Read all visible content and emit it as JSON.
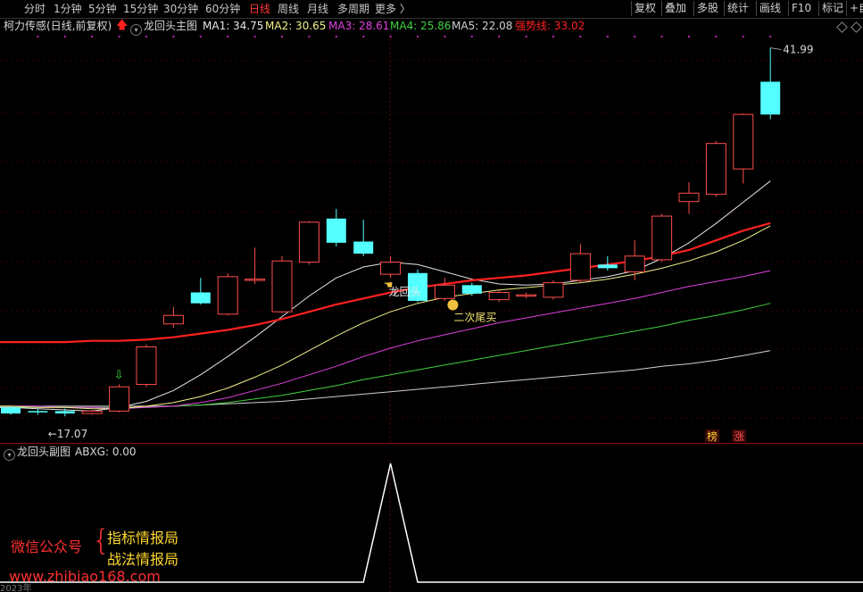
{
  "toolbar": {
    "periods": [
      {
        "label": "分时",
        "active": false
      },
      {
        "label": "1分钟",
        "active": false
      },
      {
        "label": "5分钟",
        "active": false
      },
      {
        "label": "15分钟",
        "active": false
      },
      {
        "label": "30分钟",
        "active": false
      },
      {
        "label": "60分钟",
        "active": false
      },
      {
        "label": "日线",
        "active": true
      },
      {
        "label": "周线",
        "active": false
      },
      {
        "label": "月线",
        "active": false
      },
      {
        "label": "多周期",
        "active": false
      },
      {
        "label": "更多 〉",
        "active": false
      }
    ],
    "tools": [
      "复权",
      "叠加",
      "多股",
      "统计",
      "画线",
      "F10",
      "标记",
      "+自"
    ]
  },
  "infobar": {
    "stock": "柯力传感(日线,前复权)",
    "indicator": "龙回头主图",
    "ma1": "MA1: 34.75",
    "ma2": "MA2: 30.65",
    "ma3": "MA3: 28.61",
    "ma4": "MA4: 25.86",
    "ma5": "MA5: 22.08",
    "strong": "强势线: 33.02"
  },
  "colors": {
    "up": "#ff4d4d",
    "down": "#54ffff",
    "ma1": "#e6e6e6",
    "ma2": "#f0f08a",
    "ma3": "#e040e0",
    "ma4": "#40d040",
    "ma5": "#d0d0d0",
    "strong": "#ff2020",
    "active": "#ff3b3b"
  },
  "chart_data": {
    "type": "candlestick",
    "price_labels": {
      "high": "41.99",
      "low": "17.07"
    },
    "markers": {
      "buy_arrow": "⇩",
      "longhuitou": "龙回头",
      "second_buy": "二次尾买",
      "bang": "榜",
      "zhang": "涨"
    },
    "candles": [
      {
        "o": 17.8,
        "c": 17.3,
        "h": 17.9,
        "l": 17.2
      },
      {
        "o": 17.5,
        "c": 17.4,
        "h": 17.7,
        "l": 17.2
      },
      {
        "o": 17.5,
        "c": 17.3,
        "h": 17.7,
        "l": 17.07
      },
      {
        "o": 17.3,
        "c": 17.5,
        "h": 17.6,
        "l": 17.2
      },
      {
        "o": 17.5,
        "c": 19.5,
        "h": 19.7,
        "l": 17.4
      },
      {
        "o": 19.7,
        "c": 22.8,
        "h": 23.0,
        "l": 19.5
      },
      {
        "o": 24.7,
        "c": 25.4,
        "h": 26.1,
        "l": 24.4
      },
      {
        "o": 27.3,
        "c": 26.4,
        "h": 28.5,
        "l": 26.3
      },
      {
        "o": 25.5,
        "c": 28.6,
        "h": 28.9,
        "l": 25.4
      },
      {
        "o": 28.3,
        "c": 28.4,
        "h": 31.0,
        "l": 28.0
      },
      {
        "o": 25.7,
        "c": 29.9,
        "h": 30.3,
        "l": 25.6
      },
      {
        "o": 29.8,
        "c": 33.1,
        "h": 33.2,
        "l": 29.6
      },
      {
        "o": 33.4,
        "c": 31.4,
        "h": 34.2,
        "l": 31.1
      },
      {
        "o": 31.5,
        "c": 30.5,
        "h": 33.3,
        "l": 30.3
      },
      {
        "o": 28.8,
        "c": 29.8,
        "h": 30.3,
        "l": 28.5
      },
      {
        "o": 28.9,
        "c": 26.6,
        "h": 29.2,
        "l": 26.5
      },
      {
        "o": 26.8,
        "c": 27.9,
        "h": 28.5,
        "l": 26.6
      },
      {
        "o": 27.9,
        "c": 27.2,
        "h": 28.1,
        "l": 27.0
      },
      {
        "o": 26.7,
        "c": 27.3,
        "h": 27.5,
        "l": 26.5
      },
      {
        "o": 27.0,
        "c": 27.1,
        "h": 27.3,
        "l": 26.8
      },
      {
        "o": 26.9,
        "c": 28.1,
        "h": 28.3,
        "l": 26.7
      },
      {
        "o": 28.3,
        "c": 30.5,
        "h": 31.3,
        "l": 28.1
      },
      {
        "o": 29.6,
        "c": 29.3,
        "h": 30.3,
        "l": 29.1
      },
      {
        "o": 29.0,
        "c": 30.3,
        "h": 31.6,
        "l": 28.3
      },
      {
        "o": 30.0,
        "c": 33.6,
        "h": 33.8,
        "l": 29.8
      },
      {
        "o": 34.8,
        "c": 35.5,
        "h": 36.4,
        "l": 33.8
      },
      {
        "o": 35.4,
        "c": 39.6,
        "h": 39.8,
        "l": 35.2
      },
      {
        "o": 37.5,
        "c": 42.0,
        "h": 42.1,
        "l": 36.3
      },
      {
        "o": 44.7,
        "c": 41.99,
        "h": 47.5,
        "l": 41.6
      }
    ],
    "series": {
      "ma1": [
        17.8,
        17.7,
        17.6,
        17.5,
        17.8,
        18.3,
        19.2,
        20.5,
        22.0,
        23.6,
        25.3,
        27.0,
        28.5,
        29.4,
        29.8,
        29.6,
        29.0,
        28.4,
        28.0,
        27.9,
        28.0,
        28.3,
        28.6,
        29.1,
        30.1,
        31.4,
        33.0,
        34.75,
        36.5
      ],
      "ma2": [
        17.9,
        17.8,
        17.8,
        17.7,
        17.7,
        17.9,
        18.2,
        18.7,
        19.4,
        20.3,
        21.3,
        22.5,
        23.7,
        24.8,
        25.7,
        26.4,
        26.9,
        27.2,
        27.5,
        27.7,
        27.9,
        28.1,
        28.4,
        28.8,
        29.3,
        29.9,
        30.65,
        31.6,
        32.8
      ],
      "ma3": [
        17.9,
        17.9,
        17.8,
        17.8,
        17.7,
        17.8,
        17.9,
        18.2,
        18.6,
        19.2,
        19.8,
        20.5,
        21.2,
        22.0,
        22.7,
        23.3,
        23.8,
        24.3,
        24.8,
        25.2,
        25.6,
        26.0,
        26.4,
        26.8,
        27.3,
        27.8,
        28.2,
        28.61,
        29.1
      ],
      "ma4": [
        17.8,
        17.8,
        17.8,
        17.8,
        17.8,
        17.8,
        17.9,
        18.0,
        18.2,
        18.5,
        18.8,
        19.2,
        19.6,
        20.1,
        20.5,
        20.9,
        21.3,
        21.7,
        22.1,
        22.5,
        22.9,
        23.3,
        23.7,
        24.1,
        24.5,
        25.0,
        25.4,
        25.86,
        26.4
      ],
      "ma5": [
        17.9,
        17.9,
        17.9,
        17.9,
        17.9,
        17.9,
        17.9,
        18.0,
        18.1,
        18.2,
        18.3,
        18.5,
        18.7,
        18.9,
        19.1,
        19.3,
        19.5,
        19.7,
        19.9,
        20.1,
        20.3,
        20.5,
        20.7,
        20.9,
        21.2,
        21.4,
        21.7,
        22.08,
        22.5
      ],
      "strong": [
        23.2,
        23.2,
        23.2,
        23.3,
        23.3,
        23.4,
        23.6,
        23.9,
        24.2,
        24.6,
        25.1,
        25.7,
        26.3,
        26.8,
        27.3,
        27.7,
        28.0,
        28.3,
        28.5,
        28.7,
        29.0,
        29.3,
        29.6,
        29.9,
        30.3,
        30.8,
        31.6,
        32.4,
        33.02
      ]
    },
    "ylim": [
      16.2,
      48.5
    ],
    "sub": {
      "title": "龙回头副图",
      "value_label": "ABXG: 0.00",
      "values": [
        0,
        0,
        0,
        0,
        0,
        0,
        0,
        0,
        0,
        0,
        0,
        0,
        0,
        0,
        1,
        0,
        0,
        0,
        0,
        0,
        0,
        0,
        0,
        0,
        0,
        0,
        0,
        0,
        0
      ],
      "axis_text": "2023年"
    }
  },
  "watermark": {
    "line1": "微信公众号",
    "brace": "{",
    "item1": "指标情报局",
    "item2": "战法情报局",
    "url": "www.zhibiao168.com"
  }
}
